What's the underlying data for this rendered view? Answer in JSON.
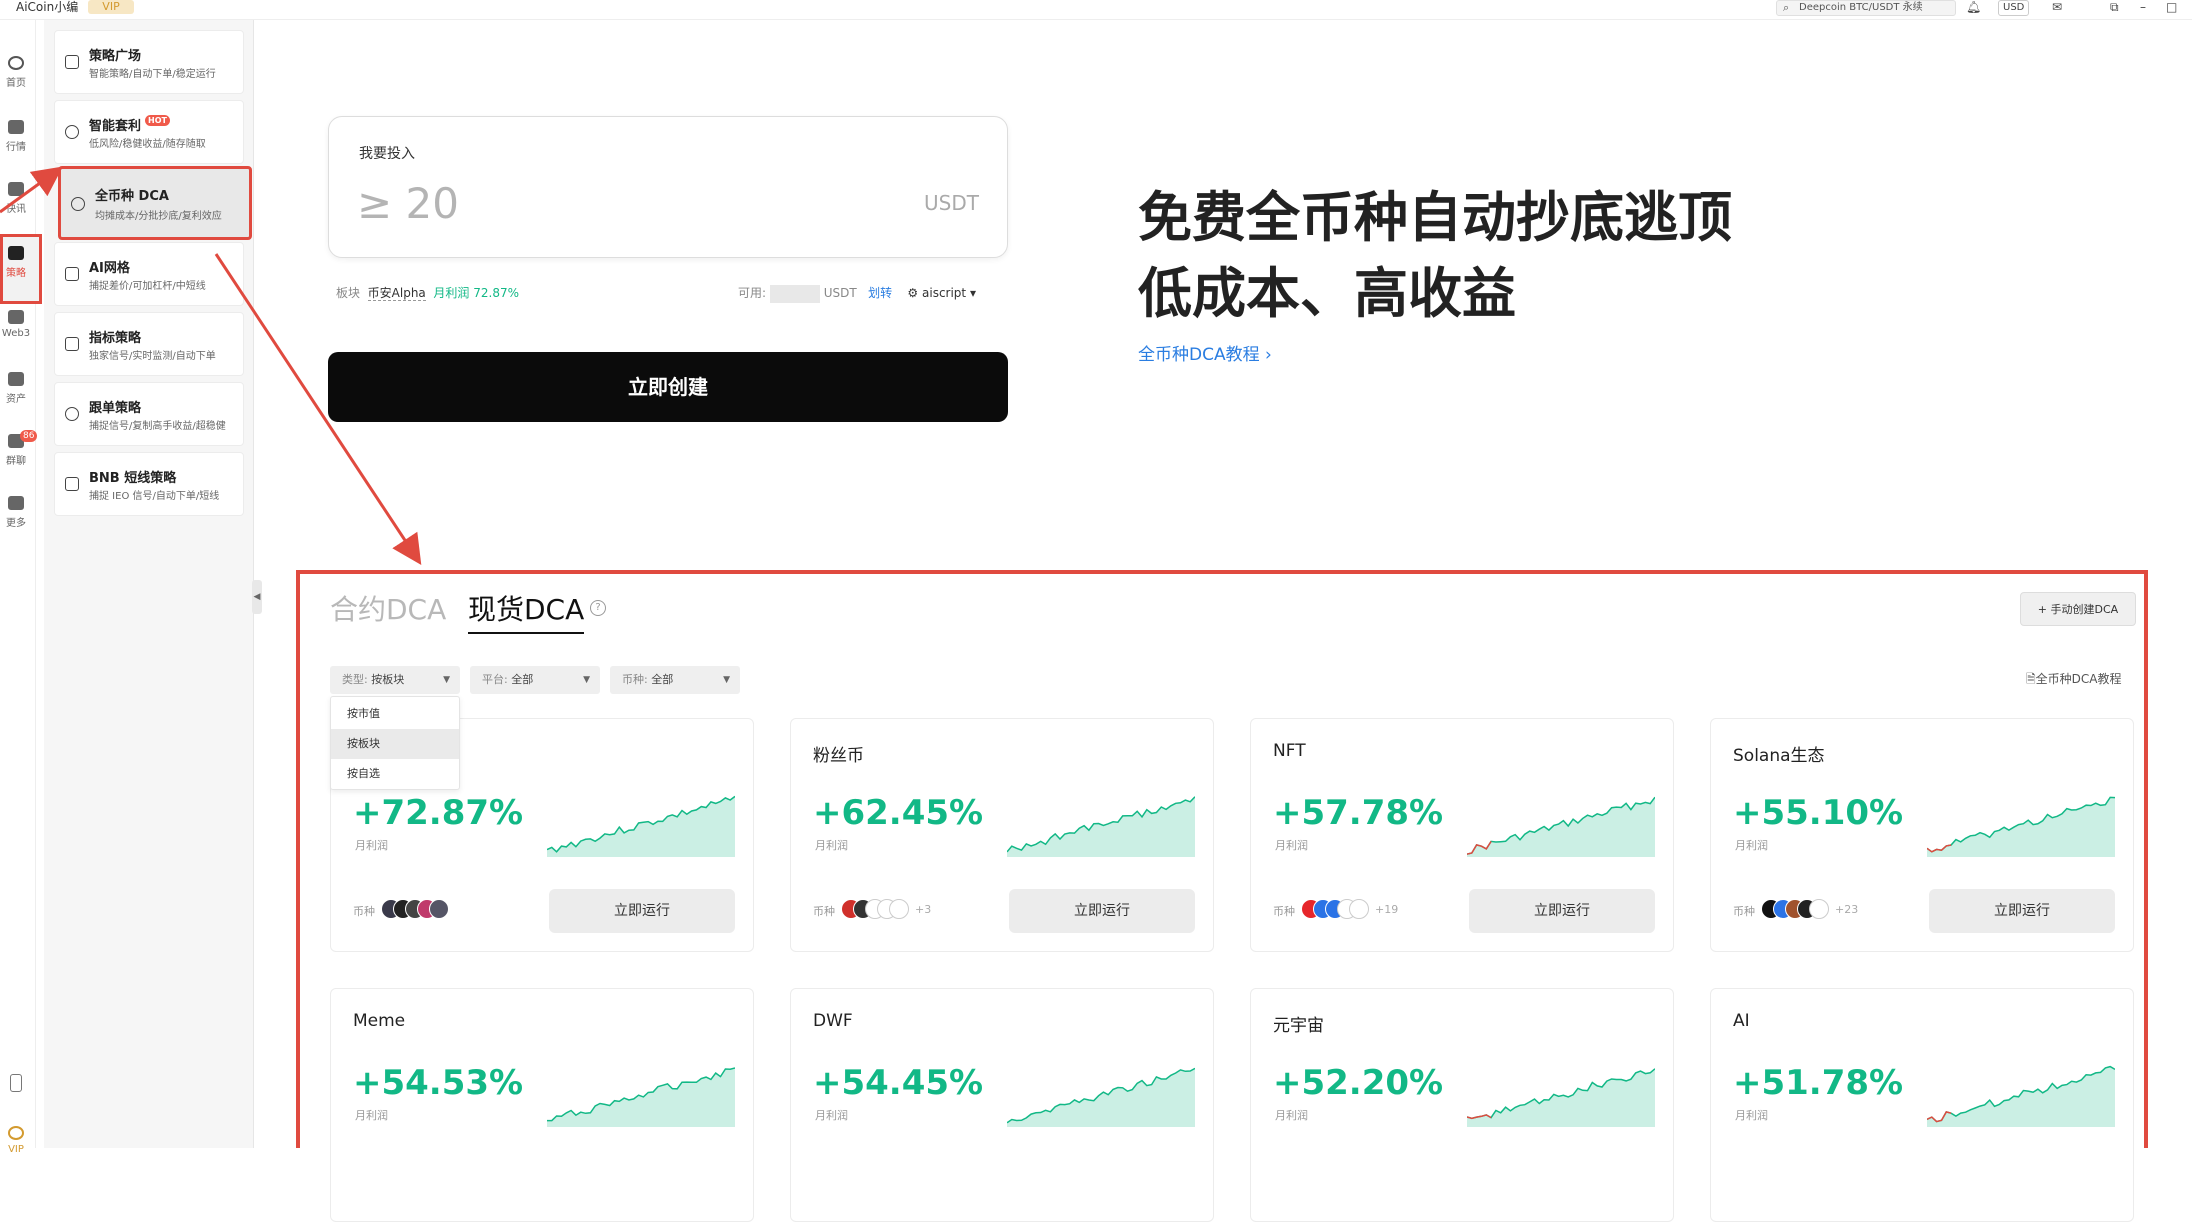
{
  "titlebar": {
    "app_name": "AiCoin小编",
    "vip": "VIP",
    "search_text": "Deepcoin BTC/USDT 永续",
    "currency": "USD"
  },
  "rail": {
    "items": [
      {
        "label": "首页"
      },
      {
        "label": "行情"
      },
      {
        "label": "快讯"
      },
      {
        "label": "策略"
      },
      {
        "label": "Web3"
      },
      {
        "label": "资产"
      },
      {
        "label": "群聊"
      },
      {
        "label": "更多"
      }
    ],
    "chat_badge": "86",
    "vip_label": "VIP"
  },
  "sidebar": {
    "items": [
      {
        "title": "策略广场",
        "sub": "智能策略/自动下单/稳定运行",
        "hot": ""
      },
      {
        "title": "智能套利",
        "sub": "低风险/稳健收益/随存随取",
        "hot": "HOT"
      },
      {
        "title": "全币种 DCA",
        "sub": "均摊成本/分批抄底/复利效应",
        "hot": ""
      },
      {
        "title": "AI网格",
        "sub": "捕捉差价/可加杠杆/中短线",
        "hot": ""
      },
      {
        "title": "指标策略",
        "sub": "独家信号/实时监测/自动下单",
        "hot": ""
      },
      {
        "title": "跟单策略",
        "sub": "捕捉信号/复制高手收益/超稳健",
        "hot": ""
      },
      {
        "title": "BNB 短线策略",
        "sub": "捕捉 IEO 信号/自动下单/短线",
        "hot": ""
      }
    ]
  },
  "invest": {
    "label": "我要投入",
    "amount": "≥ 20",
    "unit": "USDT",
    "sector_label": "板块",
    "sector_value": "币安Alpha",
    "monthly_profit": "月利润 72.87%",
    "available_label": "可用:",
    "available_unit": "USDT",
    "transfer": "划转",
    "account": "aiscript"
  },
  "create_button": "立即创建",
  "headline": {
    "line1": "免费全币种自动抄底逃顶",
    "line2": "低成本、高收益",
    "tutorial": "全币种DCA教程"
  },
  "dca": {
    "tab_contract": "合约DCA",
    "tab_spot": "现货DCA",
    "help": "?",
    "manual_create": "+ 手动创建DCA",
    "tutorial": "全币种DCA教程",
    "filters": [
      {
        "label": "类型:",
        "value": "按板块"
      },
      {
        "label": "平台:",
        "value": "全部"
      },
      {
        "label": "币种:",
        "value": "全部"
      }
    ],
    "dropdown": [
      "按市值",
      "按板块",
      "按自选"
    ],
    "dropdown_selected": 1,
    "cards": [
      {
        "name": "",
        "pct": "+72.87%",
        "plabel": "月利润",
        "coinlabel": "币种",
        "more": "",
        "run": "立即运行",
        "red_start": false
      },
      {
        "name": "粉丝币",
        "pct": "+62.45%",
        "plabel": "月利润",
        "coinlabel": "币种",
        "more": "+3",
        "run": "立即运行",
        "red_start": false
      },
      {
        "name": "NFT",
        "pct": "+57.78%",
        "plabel": "月利润",
        "coinlabel": "币种",
        "more": "+19",
        "run": "立即运行",
        "red_start": true
      },
      {
        "name": "Solana生态",
        "pct": "+55.10%",
        "plabel": "月利润",
        "coinlabel": "币种",
        "more": "+23",
        "run": "立即运行",
        "red_start": true
      },
      {
        "name": "Meme",
        "pct": "+54.53%",
        "plabel": "月利润",
        "coinlabel": "",
        "more": "",
        "run": "",
        "red_start": false
      },
      {
        "name": "DWF",
        "pct": "+54.45%",
        "plabel": "月利润",
        "coinlabel": "",
        "more": "",
        "run": "",
        "red_start": false
      },
      {
        "name": "元宇宙",
        "pct": "+52.20%",
        "plabel": "月利润",
        "coinlabel": "",
        "more": "",
        "run": "",
        "red_start": true
      },
      {
        "name": "AI",
        "pct": "+51.78%",
        "plabel": "月利润",
        "coinlabel": "",
        "more": "",
        "run": "",
        "red_start": true
      }
    ]
  },
  "colors": {
    "accent_green": "#12b886",
    "annotation_red": "#e04a3f",
    "link_blue": "#2a7de1"
  }
}
